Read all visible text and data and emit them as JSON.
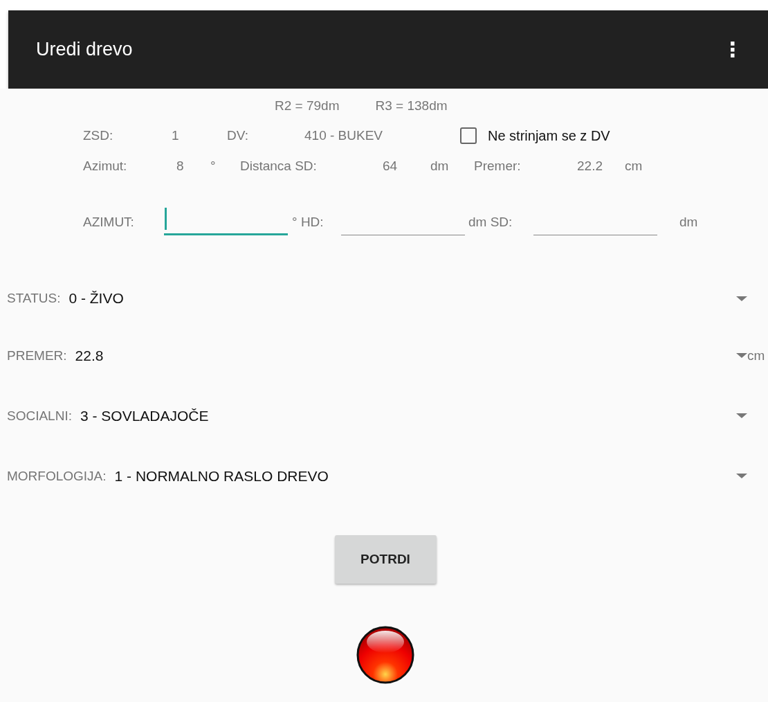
{
  "app_bar": {
    "title": "Uredi drevo",
    "menu_icon": "⋮"
  },
  "summary": [
    "R2 = 79dm",
    "R3 = 138dm"
  ],
  "info_rows": [
    [
      {
        "kind": "label",
        "text": "ZSD:"
      },
      {
        "kind": "value",
        "text": "1"
      },
      {
        "kind": "label",
        "text": "DV:"
      },
      {
        "kind": "value",
        "text": "410 - BUKEV"
      },
      {
        "kind": "checkbox",
        "label": "Ne strinjam se z DV",
        "checked": false
      }
    ],
    [
      {
        "kind": "label",
        "text": "Azimut:"
      },
      {
        "kind": "value",
        "text": "8"
      },
      {
        "kind": "value",
        "text": "°"
      },
      {
        "kind": "label",
        "text": "Distanca SD:"
      },
      {
        "kind": "value",
        "text": "64"
      },
      {
        "kind": "value",
        "text": "dm"
      },
      {
        "kind": "label",
        "text": "Premer:"
      },
      {
        "kind": "value",
        "text": "22.2"
      },
      {
        "kind": "value",
        "text": "cm"
      }
    ]
  ],
  "measure_row": [
    {
      "kind": "label",
      "text": "AZIMUT:"
    },
    {
      "kind": "field",
      "focused": true
    },
    {
      "kind": "label",
      "text": "° HD:"
    },
    {
      "kind": "field",
      "focused": false
    },
    {
      "kind": "label",
      "text": "dm SD:"
    },
    {
      "kind": "field",
      "focused": false
    },
    {
      "kind": "label",
      "text": "dm"
    }
  ],
  "dropdowns": [
    {
      "label": "STATUS:",
      "value": "0 - ŽIVO"
    },
    {
      "label": "PREMER:",
      "value": "22.8",
      "unit": "cm"
    },
    {
      "label": "SOCIALNI:",
      "value": "3 - SOVLADAJOČE"
    },
    {
      "label": "MORFOLOGIJA:",
      "value": "1 - NORMALNO RASLO DREVO"
    }
  ],
  "confirm_button": "POTRDI"
}
